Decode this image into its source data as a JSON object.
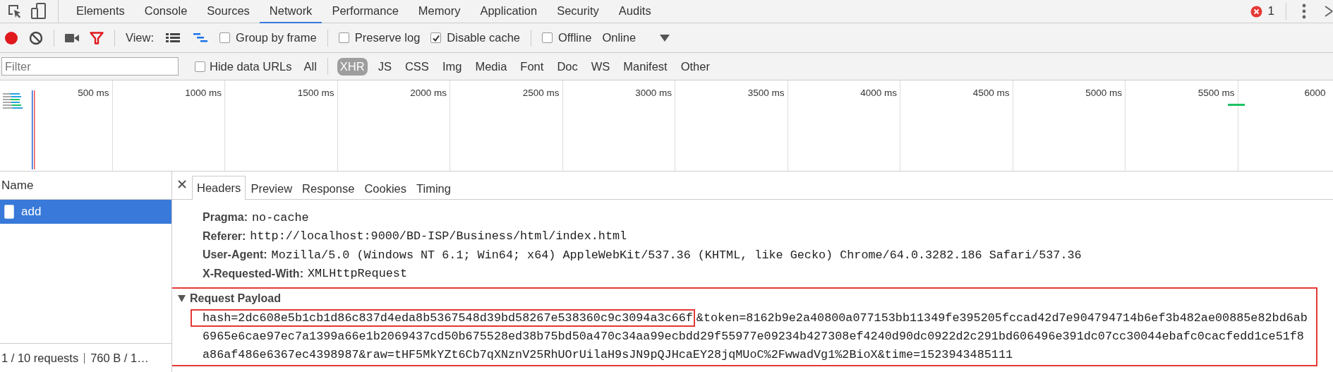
{
  "top_tabs": [
    {
      "label": "Elements",
      "selected": false
    },
    {
      "label": "Console",
      "selected": false
    },
    {
      "label": "Sources",
      "selected": false
    },
    {
      "label": "Network",
      "selected": true
    },
    {
      "label": "Performance",
      "selected": false
    },
    {
      "label": "Memory",
      "selected": false
    },
    {
      "label": "Application",
      "selected": false
    },
    {
      "label": "Security",
      "selected": false
    },
    {
      "label": "Audits",
      "selected": false
    }
  ],
  "error_count": "1",
  "toolbar": {
    "recording": true,
    "filter_active": true,
    "view_label": "View:",
    "view_buttons": [
      {
        "kind": "list",
        "selected": false
      },
      {
        "kind": "waterfall",
        "selected": true
      }
    ],
    "options": [
      {
        "label": "Group by frame",
        "checked": false
      },
      {
        "label": "Preserve log",
        "checked": false
      },
      {
        "label": "Disable cache",
        "checked": true
      },
      {
        "label": "Offline",
        "checked": false
      }
    ],
    "throttling": "Online"
  },
  "filter_bar": {
    "placeholder": "Filter",
    "hide_data_urls": {
      "label": "Hide data URLs",
      "checked": false
    },
    "types": [
      {
        "label": "All",
        "selected": false
      },
      {
        "label": "XHR",
        "selected": true
      },
      {
        "label": "JS",
        "selected": false
      },
      {
        "label": "CSS",
        "selected": false
      },
      {
        "label": "Img",
        "selected": false
      },
      {
        "label": "Media",
        "selected": false
      },
      {
        "label": "Font",
        "selected": false
      },
      {
        "label": "Doc",
        "selected": false
      },
      {
        "label": "WS",
        "selected": false
      },
      {
        "label": "Manifest",
        "selected": false
      },
      {
        "label": "Other",
        "selected": false
      }
    ]
  },
  "timeline": {
    "ticks": [
      "500 ms",
      "1000 ms",
      "1500 ms",
      "2000 ms",
      "2500 ms",
      "3000 ms",
      "3500 ms",
      "4000 ms",
      "4500 ms",
      "5000 ms",
      "5500 ms",
      "6000"
    ]
  },
  "requests": {
    "column": "Name",
    "rows": [
      {
        "name": "add",
        "selected": true
      }
    ],
    "summary": [
      "1 / 10 requests",
      "760 B / 1…"
    ]
  },
  "details": {
    "tabs": [
      {
        "label": "Headers",
        "selected": true
      },
      {
        "label": "Preview",
        "selected": false
      },
      {
        "label": "Response",
        "selected": false
      },
      {
        "label": "Cookies",
        "selected": false
      },
      {
        "label": "Timing",
        "selected": false
      }
    ],
    "headers": [
      {
        "name": "Pragma:",
        "value": "no-cache"
      },
      {
        "name": "Referer:",
        "value": "http://localhost:9000/BD-ISP/Business/html/index.html"
      },
      {
        "name": "User-Agent:",
        "value": "Mozilla/5.0 (Windows NT 6.1; Win64; x64) AppleWebKit/537.36 (KHTML, like Gecko) Chrome/64.0.3282.186 Safari/537.36"
      },
      {
        "name": "X-Requested-With:",
        "value": "XMLHttpRequest"
      }
    ],
    "payload": {
      "title": "Request Payload",
      "expanded": true,
      "highlighted": true,
      "lines": [
        [
          {
            "text": "hash=2dc608e5b1cb1d86c837d4eda8b5367548d39bd58267e538360c9c3094a3c66f",
            "boxed": true
          },
          {
            "text": "&token=8162b9e2a40800a077153bb11349fe395205fccad42d7e904794714b6ef3b482ae00885e82bd6ab",
            "boxed": false
          }
        ],
        [
          {
            "text": "6965e6cae97ec7a1399a66e1b2069437cd50b675528ed38b75bd50a470c34aa99ecbdd29f55977e09234b427308ef4240d90dc0922d2c291bd606496e391dc07cc30044ebafc0cacfedd1ce51f8",
            "boxed": false
          }
        ],
        [
          {
            "text": "a86af486e6367ec4398987&raw=tHF5MkYZt6Cb7qXNznV25RhUOrUilaH9sJN9pQJHcaEY28jqMUoC%2FwwadVg1%2BioX&time=1523943485111",
            "boxed": false
          }
        ]
      ]
    }
  }
}
